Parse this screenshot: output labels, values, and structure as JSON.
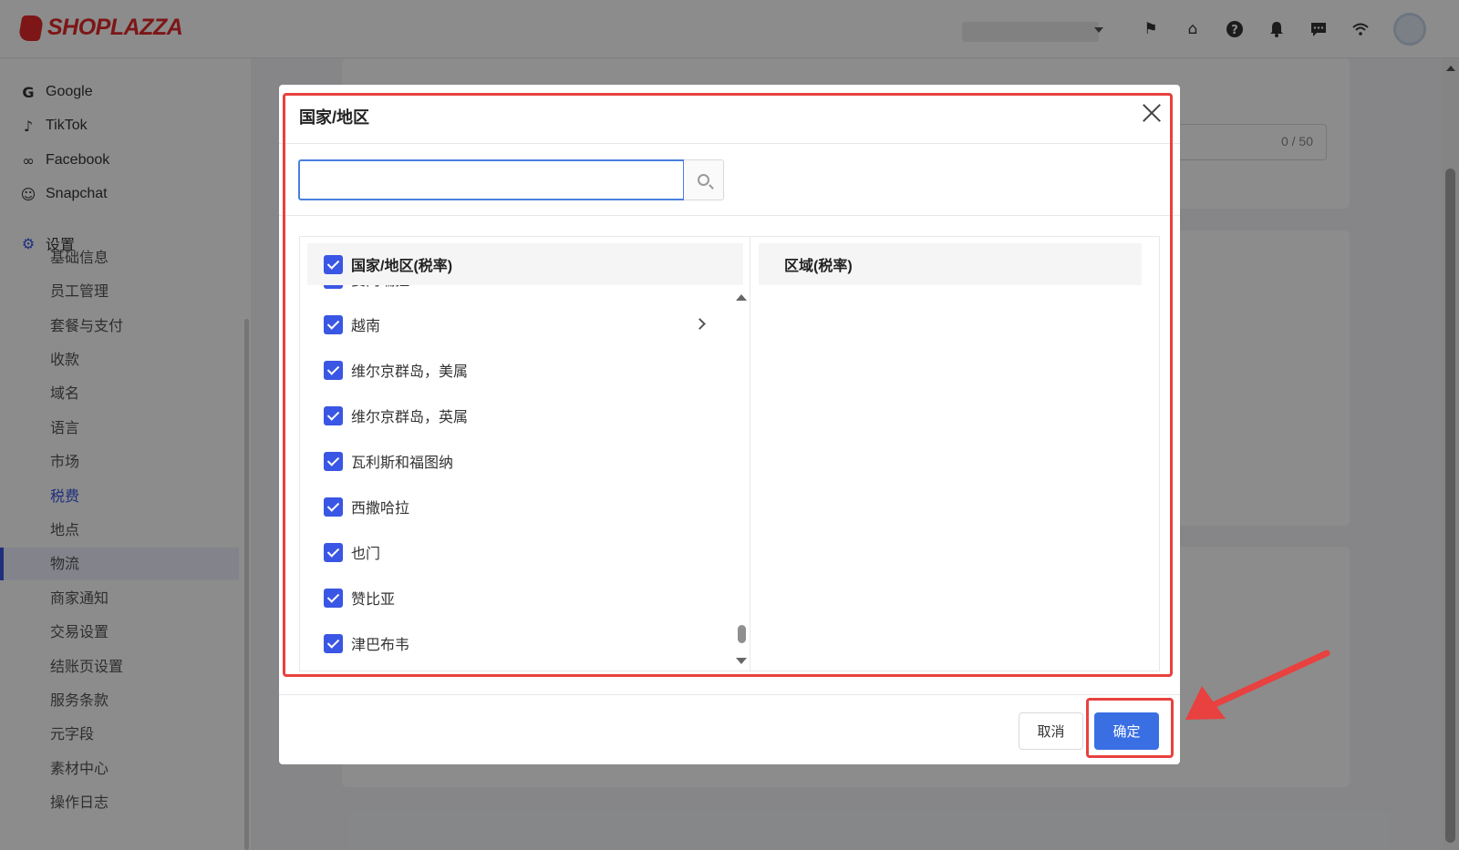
{
  "brand": {
    "name": "SHOPLAZZA"
  },
  "topbar": {
    "icons": [
      "flag-icon",
      "store-icon",
      "help-icon",
      "bell-icon",
      "message-icon",
      "wifi-icon"
    ]
  },
  "sidebar": {
    "channels": [
      {
        "label": "Google",
        "icon": "google-icon"
      },
      {
        "label": "TikTok",
        "icon": "tiktok-icon"
      },
      {
        "label": "Facebook",
        "icon": "meta-icon"
      },
      {
        "label": "Snapchat",
        "icon": "snapchat-icon"
      }
    ],
    "settings_label": "设置",
    "settings_items": [
      "基础信息",
      "员工管理",
      "套餐与支付",
      "收款",
      "域名",
      "语言",
      "市场",
      "税费",
      "地点",
      "物流",
      "商家通知",
      "交易设置",
      "结账页设置",
      "服务条款",
      "元字段",
      "素材中心",
      "操作日志"
    ],
    "active_item": "税费"
  },
  "background": {
    "field_counter": "0 / 50"
  },
  "modal": {
    "title": "国家/地区",
    "search": {
      "value": "",
      "placeholder": ""
    },
    "left_header": "国家/地区(税率)",
    "right_header": "区域(税率)",
    "countries": [
      "委内瑞拉",
      "越南",
      "维尔京群岛，美属",
      "维尔京群岛，英属",
      "瓦利斯和福图纳",
      "西撒哈拉",
      "也门",
      "赞比亚",
      "津巴布韦"
    ],
    "cancel_label": "取消",
    "confirm_label": "确定"
  },
  "annotation": {
    "color": "#e8413f"
  },
  "colors": {
    "accent": "#3a56e4",
    "primary_button": "#3a6fe4",
    "brand": "#e4292b"
  }
}
